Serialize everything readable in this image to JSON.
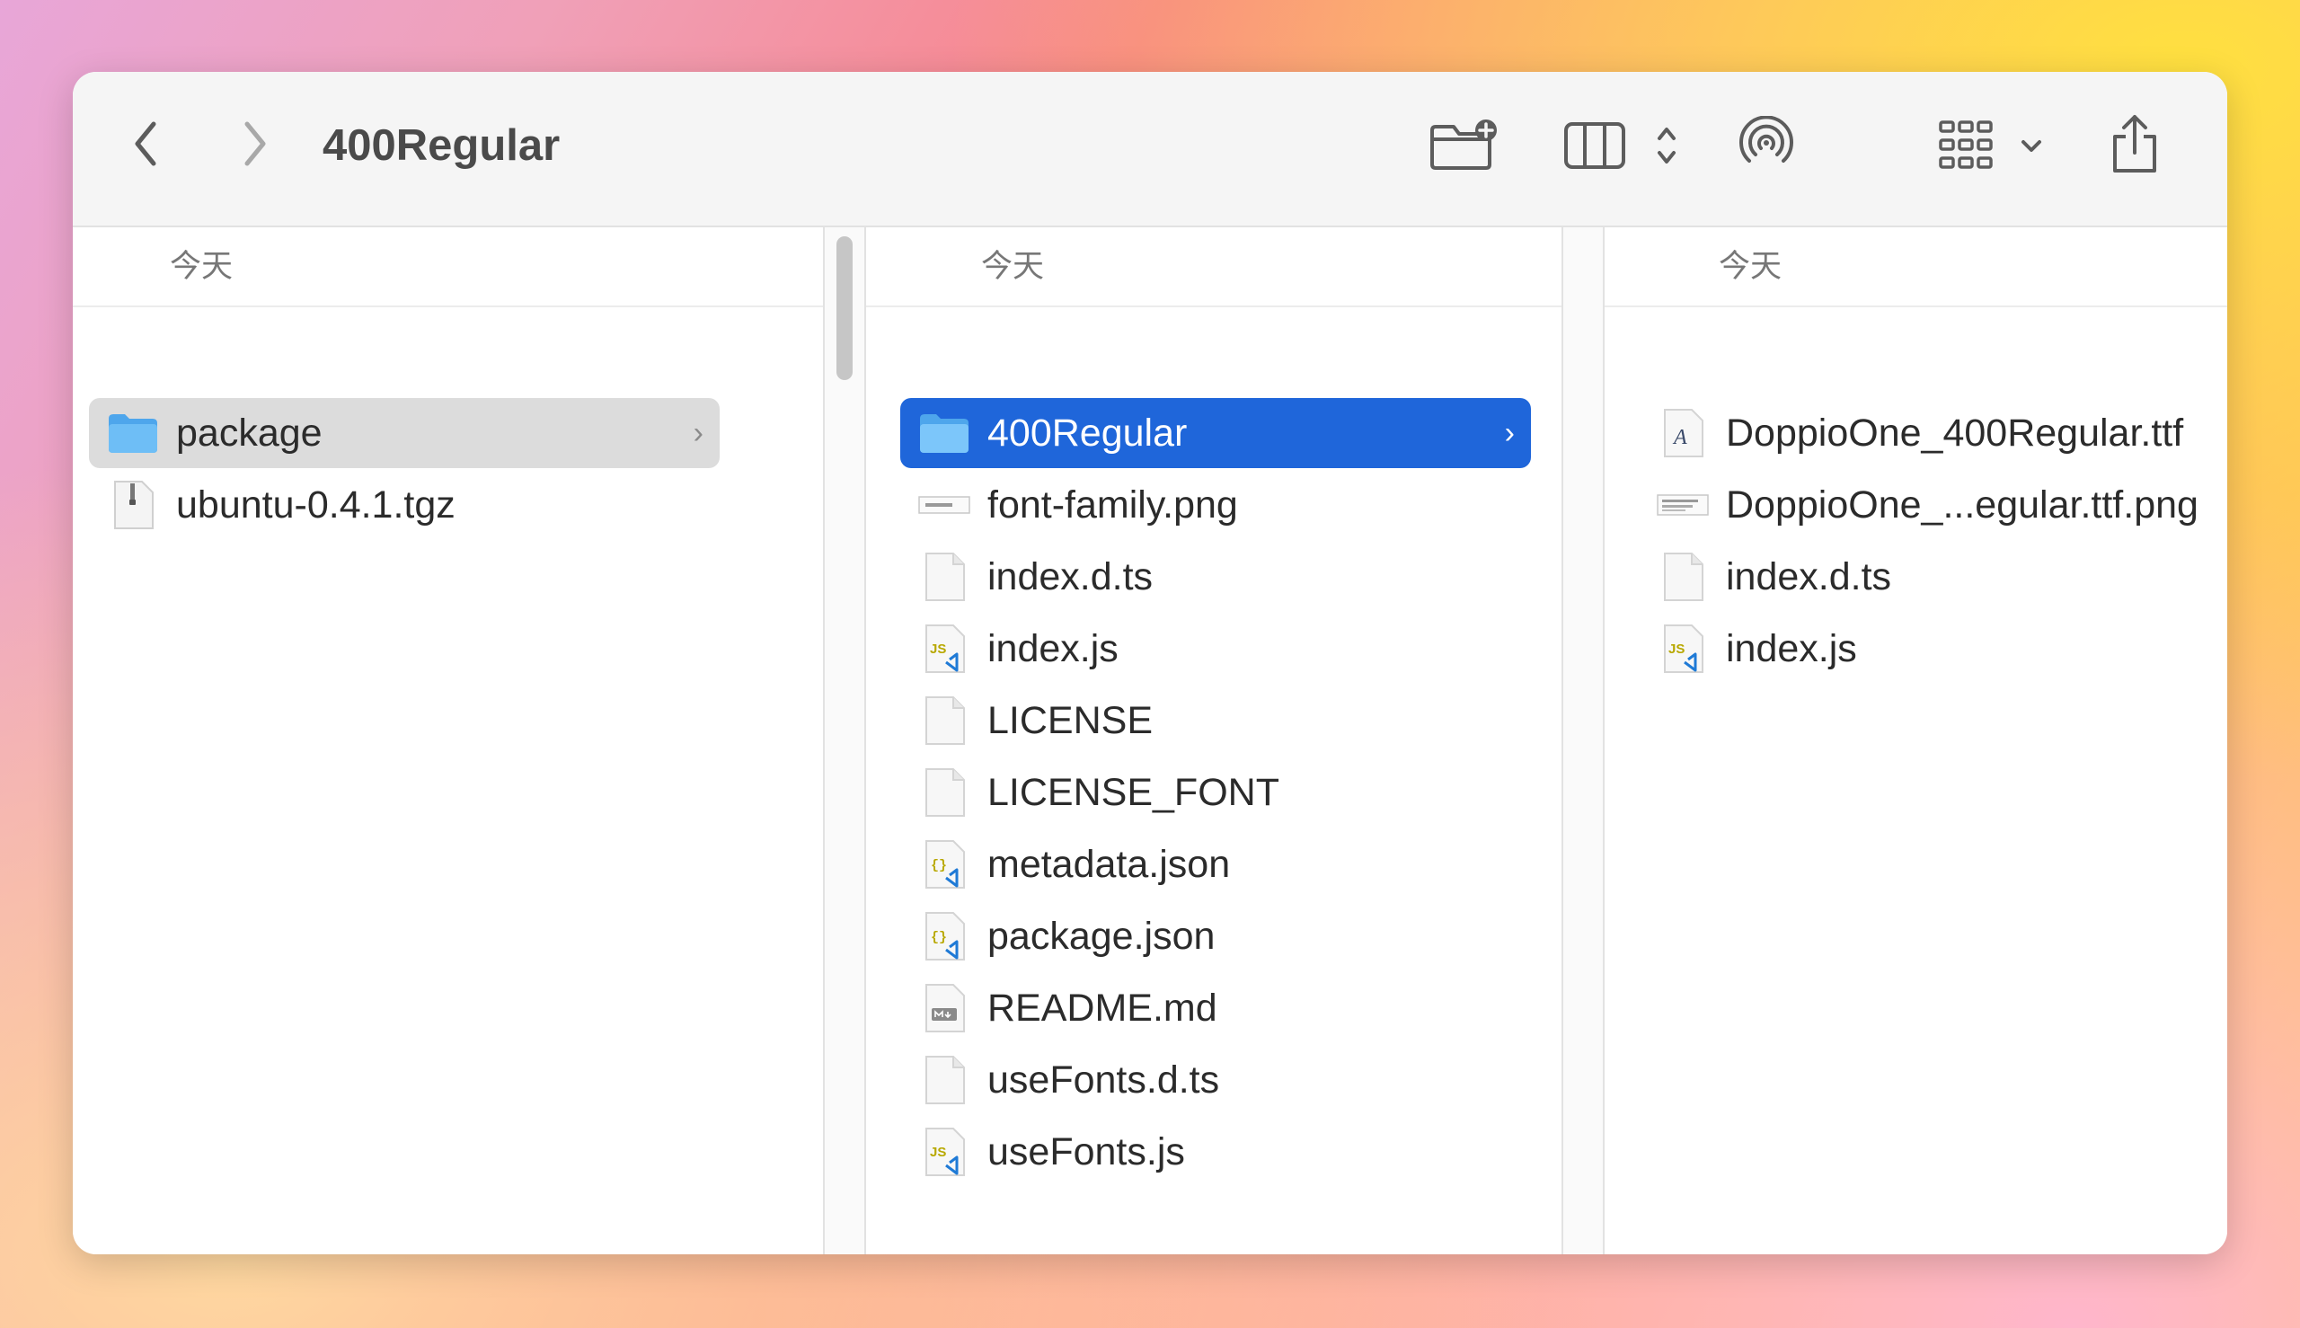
{
  "window": {
    "title": "400Regular"
  },
  "toolbar": {
    "icons": [
      "back-chevron-icon",
      "forward-chevron-icon",
      "new-folder-icon",
      "column-view-icon",
      "airdrop-icon",
      "group-grid-icon",
      "share-icon"
    ]
  },
  "columns": [
    {
      "header": "今天",
      "items": [
        {
          "name": "package",
          "kind": "folder",
          "selected": "inactive",
          "has_children": true
        },
        {
          "name": "ubuntu-0.4.1.tgz",
          "kind": "archive"
        }
      ]
    },
    {
      "header": "今天",
      "items": [
        {
          "name": "400Regular",
          "kind": "folder",
          "selected": "active",
          "has_children": true
        },
        {
          "name": "font-family.png",
          "kind": "image-preview"
        },
        {
          "name": "index.d.ts",
          "kind": "blank-doc"
        },
        {
          "name": "index.js",
          "kind": "js"
        },
        {
          "name": "LICENSE",
          "kind": "blank-doc"
        },
        {
          "name": "LICENSE_FONT",
          "kind": "blank-doc"
        },
        {
          "name": "metadata.json",
          "kind": "json"
        },
        {
          "name": "package.json",
          "kind": "json"
        },
        {
          "name": "README.md",
          "kind": "markdown"
        },
        {
          "name": "useFonts.d.ts",
          "kind": "blank-doc"
        },
        {
          "name": "useFonts.js",
          "kind": "js"
        }
      ]
    },
    {
      "header": "今天",
      "items": [
        {
          "name": "DoppioOne_400Regular.ttf",
          "kind": "font"
        },
        {
          "name": "DoppioOne_...egular.ttf.png",
          "kind": "image-preview"
        },
        {
          "name": "index.d.ts",
          "kind": "blank-doc"
        },
        {
          "name": "index.js",
          "kind": "js"
        }
      ]
    }
  ],
  "colors": {
    "selection_active": "#1f66da",
    "selection_inactive": "#dcdcdc",
    "folder": "#5fb4f4",
    "js_badge": "#b8a800",
    "vscode_badge": "#1f7ad6"
  }
}
